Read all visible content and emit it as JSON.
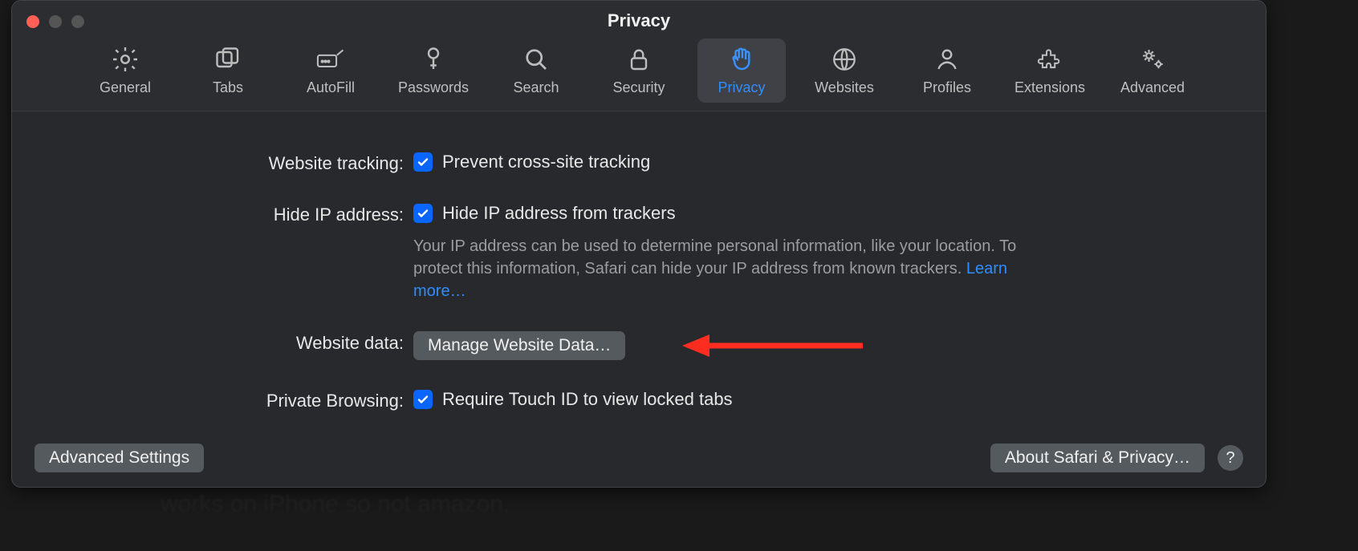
{
  "window": {
    "title": "Privacy"
  },
  "tabs": {
    "general": "General",
    "tabs": "Tabs",
    "autofill": "AutoFill",
    "passwords": "Passwords",
    "search": "Search",
    "security": "Security",
    "privacy": "Privacy",
    "websites": "Websites",
    "profiles": "Profiles",
    "extensions": "Extensions",
    "advanced": "Advanced"
  },
  "rows": {
    "tracking": {
      "label": "Website tracking:",
      "option": "Prevent cross-site tracking",
      "checked": true
    },
    "hideip": {
      "label": "Hide IP address:",
      "option": "Hide IP address from trackers",
      "checked": true,
      "desc": "Your IP address can be used to determine personal information, like your location. To protect this information, Safari can hide your IP address from known trackers.",
      "learn": "Learn more…"
    },
    "websitedata": {
      "label": "Website data:",
      "button": "Manage Website Data…"
    },
    "privatebrowsing": {
      "label": "Private Browsing:",
      "option": "Require Touch ID to view locked tabs",
      "checked": true
    }
  },
  "footer": {
    "advanced": "Advanced Settings",
    "about": "About Safari & Privacy…",
    "help": "?"
  },
  "bg_text": "works on iPhone so not amazon."
}
